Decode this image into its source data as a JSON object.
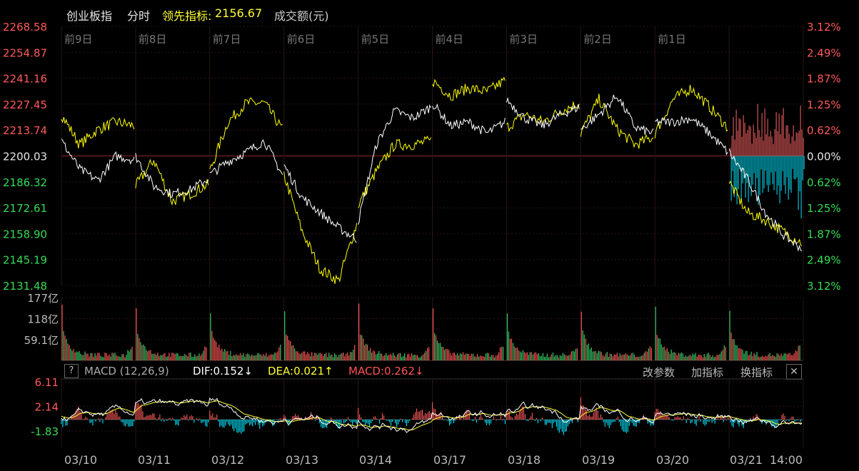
{
  "header": {
    "index_name": "创业板指",
    "mode": "分时",
    "leading_label": "领先指标:",
    "leading_value": "2156.67",
    "amount_label": "成交额(元)"
  },
  "colors": {
    "white_line": "#ffffff",
    "yellow_line": "#ffff00",
    "up": "#ff5555",
    "down": "#00ffff",
    "grid": "#2a1a1a",
    "vol_up": "#ff5555",
    "vol_down": "#33cc66"
  },
  "chart_data": [
    {
      "type": "line",
      "panel": "price",
      "y_left_ticks": [
        "2268.58",
        "2254.87",
        "2241.16",
        "2227.45",
        "2213.74",
        "2200.03",
        "2186.32",
        "2172.61",
        "2158.90",
        "2145.19",
        "2131.48"
      ],
      "y_right_ticks": [
        "3.12%",
        "2.49%",
        "1.87%",
        "1.25%",
        "0.62%",
        "0.00%",
        "0.62%",
        "1.25%",
        "1.87%",
        "2.49%",
        "3.12%"
      ],
      "ylim": [
        2131.48,
        2268.58
      ],
      "day_labels": [
        "前9日",
        "前8日",
        "前7日",
        "前6日",
        "前5日",
        "前4日",
        "前3日",
        "前2日",
        "前1日"
      ],
      "series": [
        {
          "key": "index",
          "points": [
            [
              2208,
              2193,
              2187,
              2200,
              2198
            ],
            [
              2200,
              2184,
              2180,
              2182,
              2188
            ],
            [
              2190,
              2197,
              2202,
              2208,
              2190
            ],
            [
              2195,
              2178,
              2170,
              2162,
              2156
            ],
            [
              2165,
              2206,
              2224,
              2220,
              2226
            ],
            [
              2228,
              2216,
              2218,
              2212,
              2218
            ],
            [
              2230,
              2220,
              2216,
              2222,
              2226
            ],
            [
              2214,
              2222,
              2232,
              2215,
              2212
            ],
            [
              2218,
              2218,
              2220,
              2212,
              2202
            ],
            [
              2202,
              2188,
              2170,
              2158,
              2151
            ]
          ]
        },
        {
          "key": "leading",
          "points": [
            [
              2222,
              2206,
              2214,
              2218,
              2216
            ],
            [
              2184,
              2198,
              2176,
              2180,
              2185
            ],
            [
              2192,
              2218,
              2228,
              2228,
              2214
            ],
            [
              2190,
              2160,
              2140,
              2134,
              2164
            ],
            [
              2174,
              2192,
              2206,
              2206,
              2208
            ],
            [
              2240,
              2232,
              2236,
              2234,
              2240
            ],
            [
              2215,
              2222,
              2218,
              2224,
              2228
            ],
            [
              2212,
              2230,
              2214,
              2206,
              2210
            ],
            [
              2212,
              2230,
              2236,
              2226,
              2215
            ],
            [
              2186,
              2170,
              2166,
              2160,
              2154
            ]
          ]
        }
      ],
      "last_day_ratio": {
        "ups": [
          0.5,
          0.9,
          1.2,
          0.7,
          1.4,
          0.8,
          1.1,
          1.5,
          0.6,
          1.3,
          0.9,
          1.2,
          0.7,
          1.0,
          0.8
        ],
        "downs": [
          1.0,
          0.6,
          1.2,
          0.8,
          1.4,
          0.9,
          0.5,
          1.1,
          1.3,
          0.7,
          1.0,
          0.8,
          1.2,
          0.6,
          0.9
        ]
      }
    },
    {
      "type": "bar",
      "panel": "volume",
      "y_ticks": [
        "177亿",
        "118亿",
        "59.1亿"
      ],
      "ylim": [
        0,
        177
      ],
      "unit": "亿"
    },
    {
      "type": "bar",
      "panel": "macd",
      "title": "MACD (12,26,9)",
      "y_ticks": [
        "6.11",
        "2.14",
        "-1.83"
      ],
      "ylim": [
        -4.5,
        6.11
      ]
    }
  ],
  "macd_header": {
    "help": "?",
    "name": "MACD (12,26,9)",
    "dif": "DIF:0.152↓",
    "dea": "DEA:0.021↑",
    "macd": "MACD:0.262↓",
    "btn_params": "改参数",
    "btn_add": "加指标",
    "btn_switch": "换指标",
    "close": "✕"
  },
  "dates": [
    "03/10",
    "03/11",
    "03/12",
    "03/13",
    "03/14",
    "03/17",
    "03/18",
    "03/19",
    "03/20",
    "03/21",
    "14:00"
  ]
}
